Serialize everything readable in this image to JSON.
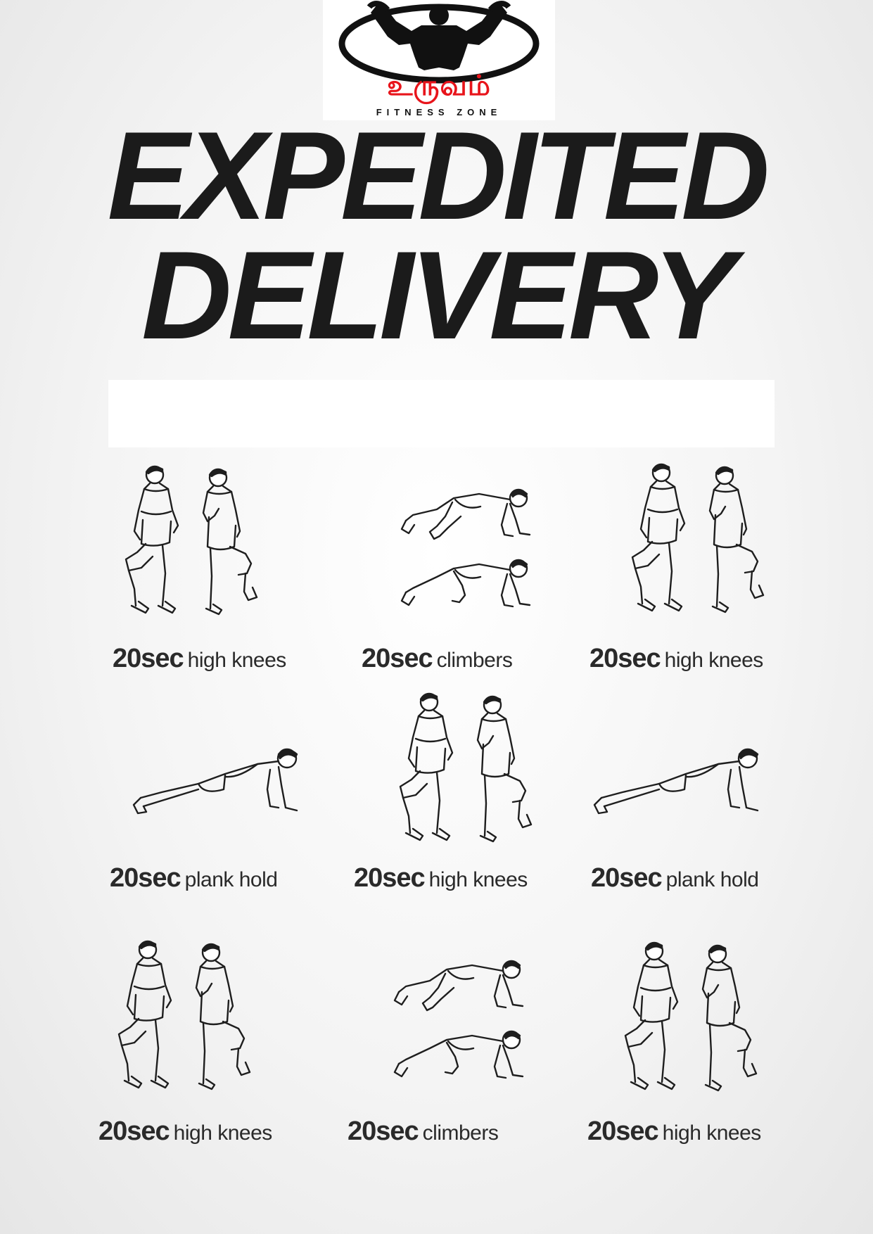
{
  "logo": {
    "icon": "bodybuilder-silhouette-icon",
    "tamil_text": "உருவம்",
    "subtitle": "FITNESS ZONE",
    "accent": "#e8141b"
  },
  "title": {
    "line1": "EXPEDITED",
    "line2": "DELIVERY"
  },
  "exercises": [
    {
      "duration": "20sec",
      "name": "high knees",
      "icon": "high-knees-icon"
    },
    {
      "duration": "20sec",
      "name": "climbers",
      "icon": "climbers-icon"
    },
    {
      "duration": "20sec",
      "name": "high knees",
      "icon": "high-knees-icon"
    },
    {
      "duration": "20sec",
      "name": "plank hold",
      "icon": "plank-hold-icon"
    },
    {
      "duration": "20sec",
      "name": "high knees",
      "icon": "high-knees-icon"
    },
    {
      "duration": "20sec",
      "name": "plank hold",
      "icon": "plank-hold-icon"
    },
    {
      "duration": "20sec",
      "name": "high knees",
      "icon": "high-knees-icon"
    },
    {
      "duration": "20sec",
      "name": "climbers",
      "icon": "climbers-icon"
    },
    {
      "duration": "20sec",
      "name": "high knees",
      "icon": "high-knees-icon"
    }
  ]
}
